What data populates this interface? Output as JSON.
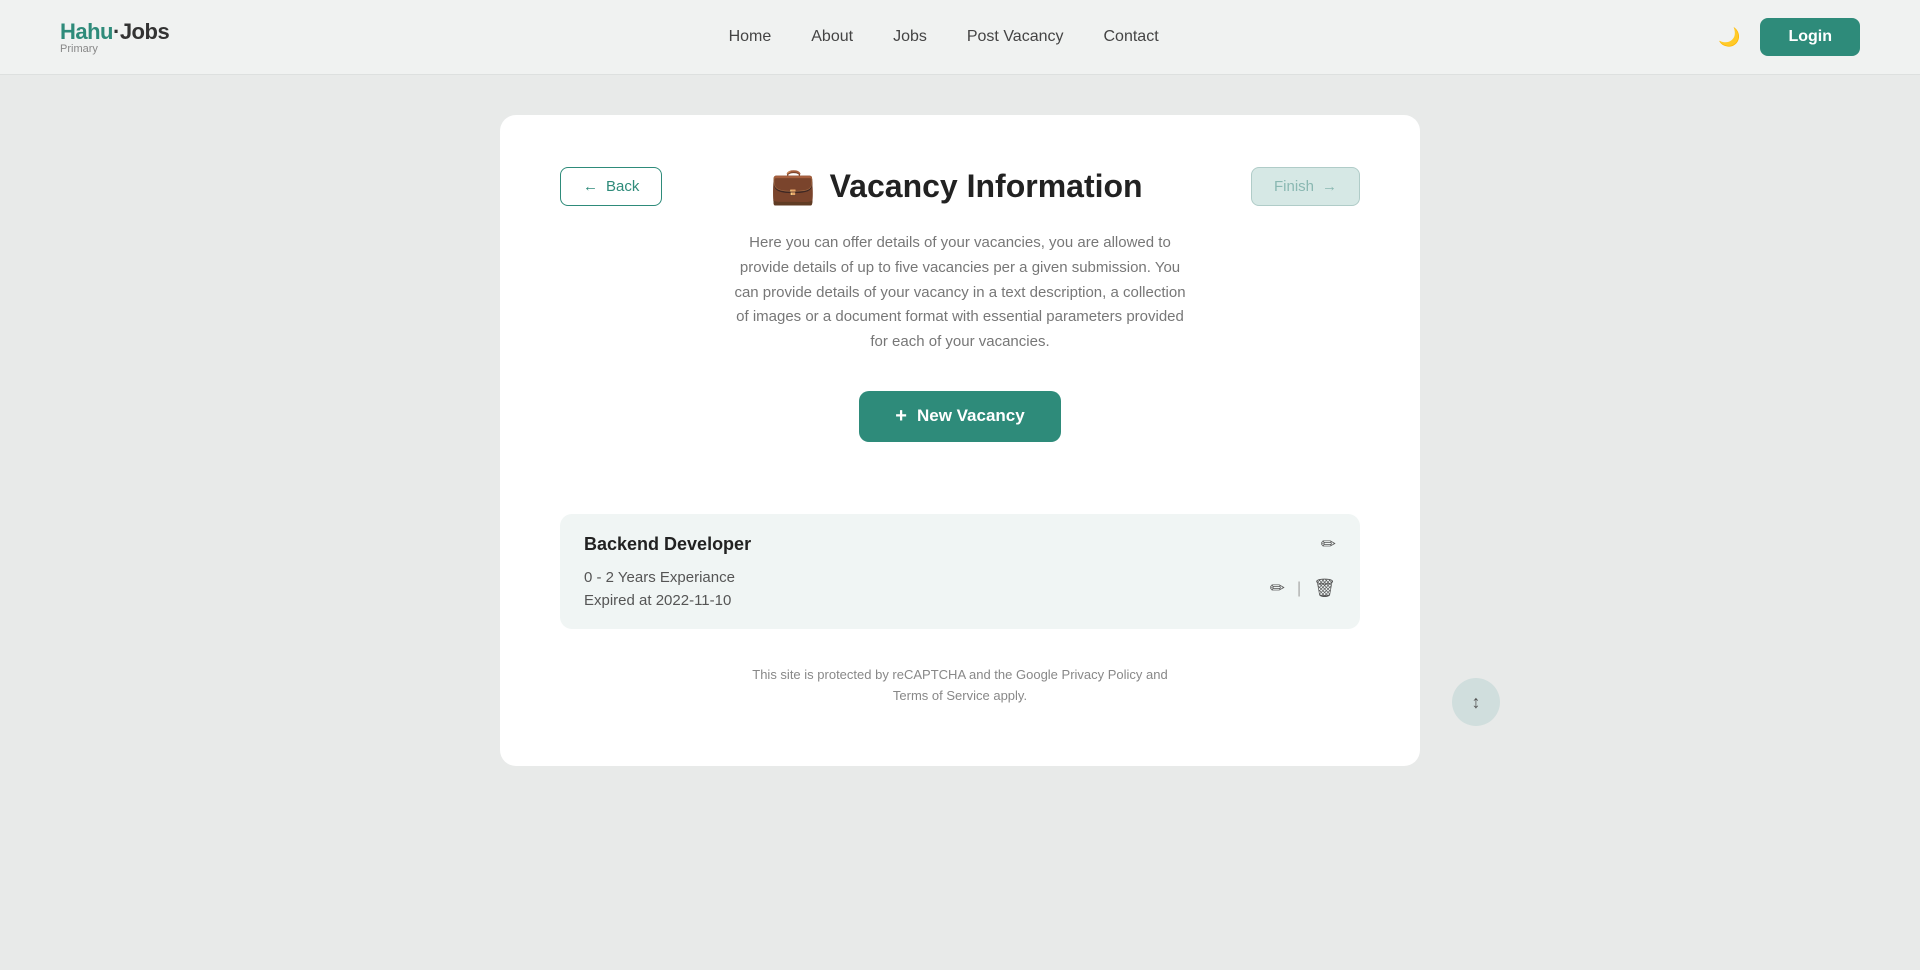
{
  "navbar": {
    "logo": "Hahu·Jobs",
    "logo_sub": "Primary",
    "links": [
      {
        "label": "Home",
        "name": "home"
      },
      {
        "label": "About",
        "name": "about"
      },
      {
        "label": "Jobs",
        "name": "jobs"
      },
      {
        "label": "Post Vacancy",
        "name": "post-vacancy"
      },
      {
        "label": "Contact",
        "name": "contact"
      }
    ],
    "login_label": "Login"
  },
  "card": {
    "back_label": "Back",
    "finish_label": "Finish",
    "page_title": "Vacancy Information",
    "description": "Here you can offer details of your vacancies, you are allowed to provide details of up to five vacancies per a given submission. You can provide details of your vacancy in a text description, a collection of images or a document format with essential parameters provided for each of your vacancies.",
    "new_vacancy_label": "New Vacancy",
    "vacancy": {
      "title": "Backend Developer",
      "experience": "0 - 2 Years Experiance",
      "expiry": "Expired at 2022-11-10"
    },
    "recaptcha": {
      "line1": "This site is protected by reCAPTCHA and the Google Privacy Policy and",
      "line2": "Terms of Service apply."
    }
  }
}
